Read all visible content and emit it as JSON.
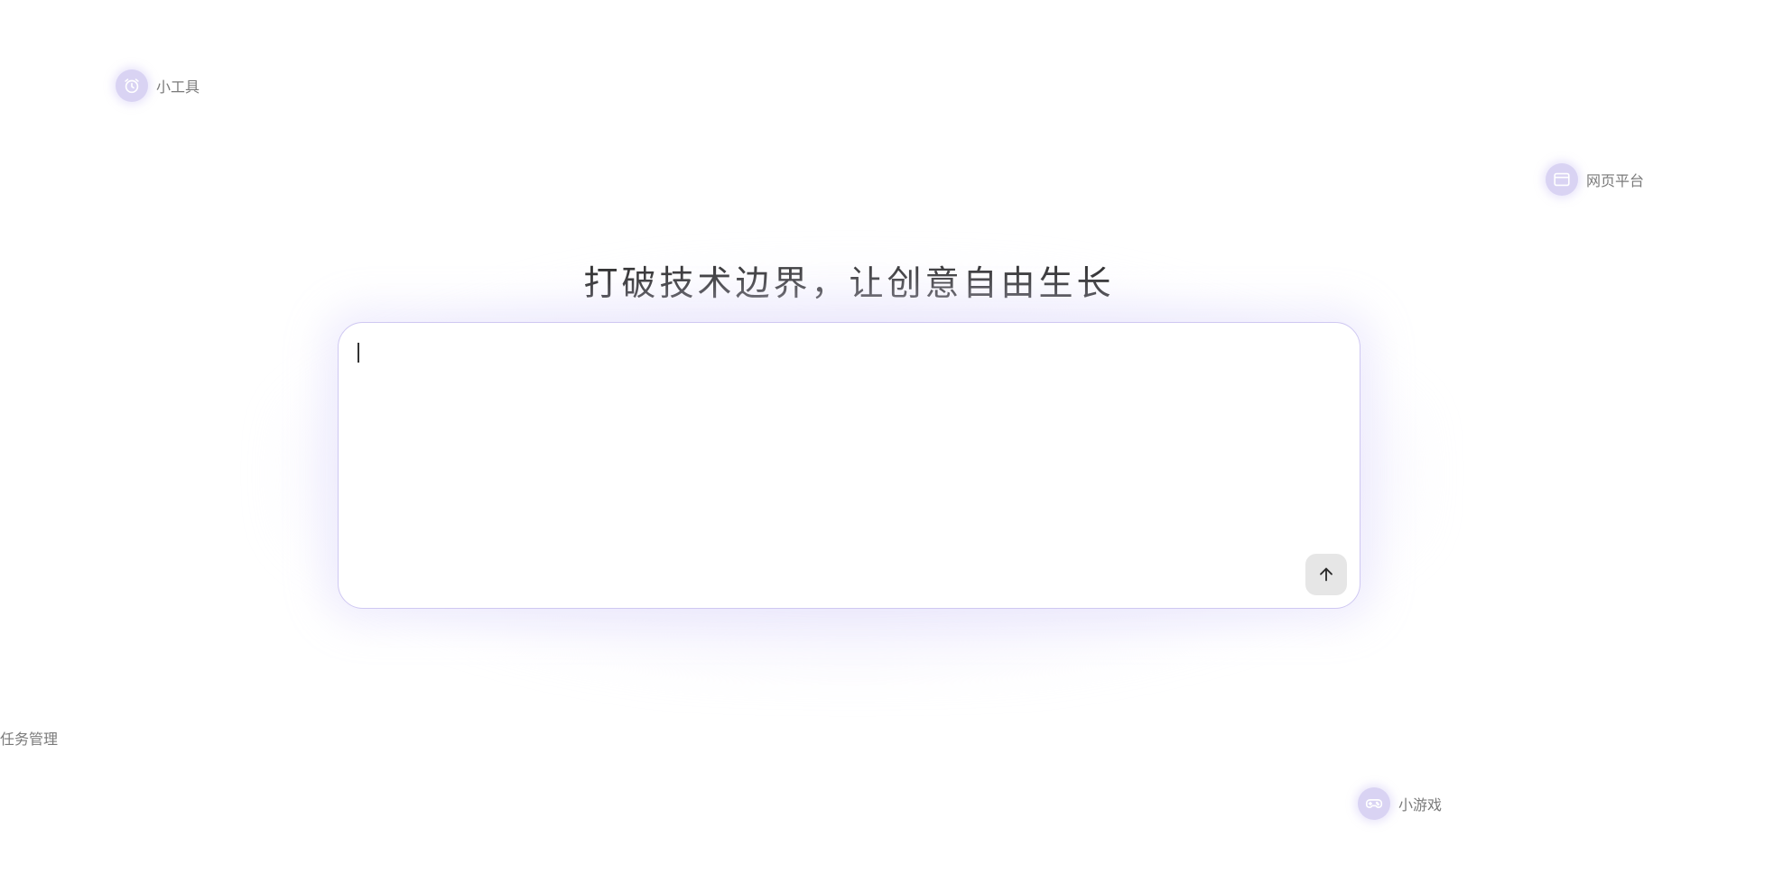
{
  "headline": "打破技术边界，让创意自由生长",
  "prompt": {
    "value": "",
    "placeholder": ""
  },
  "send_button": {
    "icon": "arrow-up-icon"
  },
  "chips": [
    {
      "id": "tools",
      "label": "小工具",
      "icon": "alarm-clock-icon"
    },
    {
      "id": "web",
      "label": "网页平台",
      "icon": "browser-window-icon"
    },
    {
      "id": "games",
      "label": "小游戏",
      "icon": "gamepad-icon"
    },
    {
      "id": "tasks",
      "label": "任务管理",
      "icon": ""
    }
  ],
  "colors": {
    "accent": "#cfc8f2",
    "chip_icon_bg": "#d9d3f3",
    "chip_icon_fg": "#ffffff",
    "label": "#7a7a7a",
    "headline": "#2e2e2e"
  }
}
